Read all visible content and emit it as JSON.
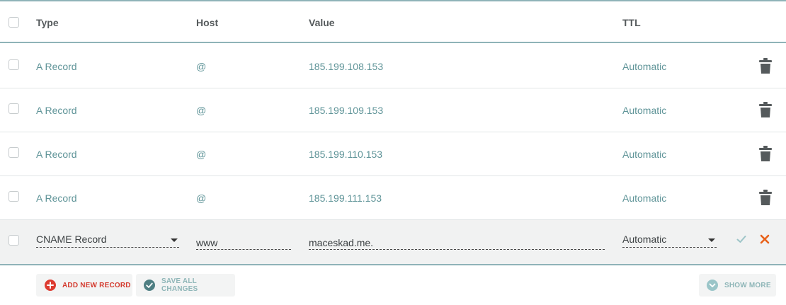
{
  "header": {
    "type_label": "Type",
    "host_label": "Host",
    "value_label": "Value",
    "ttl_label": "TTL"
  },
  "records": [
    {
      "type": "A Record",
      "host": "@",
      "value": "185.199.108.153",
      "ttl": "Automatic"
    },
    {
      "type": "A Record",
      "host": "@",
      "value": "185.199.109.153",
      "ttl": "Automatic"
    },
    {
      "type": "A Record",
      "host": "@",
      "value": "185.199.110.153",
      "ttl": "Automatic"
    },
    {
      "type": "A Record",
      "host": "@",
      "value": "185.199.111.153",
      "ttl": "Automatic"
    }
  ],
  "edit_row": {
    "type": "CNAME Record",
    "host": "www",
    "value": "maceskad.me.",
    "ttl": "Automatic"
  },
  "buttons": {
    "add_new_record": "ADD NEW RECORD",
    "save_all_changes": "SAVE ALL CHANGES",
    "show_more": "SHOW MORE"
  },
  "icons": {
    "row_action": "trash-icon",
    "confirm": "check-icon",
    "cancel": "close-icon",
    "add": "plus-circle-icon",
    "save": "check-circle-icon",
    "more": "chevron-down-circle-icon"
  },
  "colors": {
    "accent_teal": "#5f9498",
    "divider": "#8fb3b8",
    "danger": "#dd3b30",
    "cancel_orange": "#e8611a",
    "trash_gray": "#555a5c"
  }
}
